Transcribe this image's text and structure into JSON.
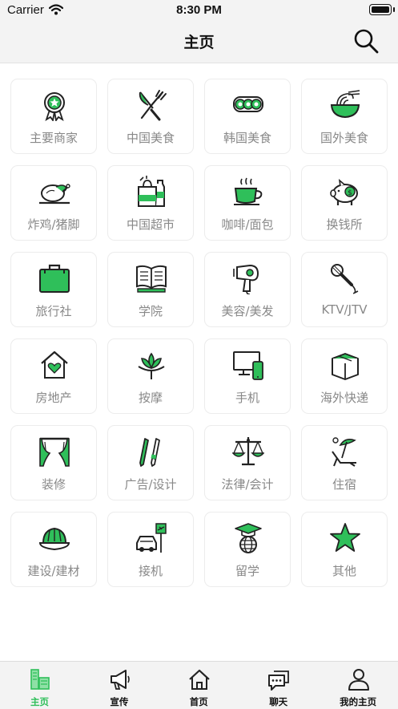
{
  "status_bar": {
    "carrier": "Carrier",
    "time": "8:30 PM"
  },
  "nav": {
    "title": "主页",
    "search_icon": "search-icon"
  },
  "accent_color": "#2fbf5a",
  "categories": [
    {
      "label": "主要商家",
      "icon": "award-ribbon-icon"
    },
    {
      "label": "中国美食",
      "icon": "knife-fork-icon"
    },
    {
      "label": "韩国美食",
      "icon": "kimbap-rolls-icon"
    },
    {
      "label": "国外美食",
      "icon": "noodle-bowl-icon"
    },
    {
      "label": "炸鸡/猪脚",
      "icon": "roast-chicken-icon"
    },
    {
      "label": "中国超市",
      "icon": "grocery-bag-icon"
    },
    {
      "label": "咖啡/面包",
      "icon": "coffee-cup-icon"
    },
    {
      "label": "换钱所",
      "icon": "piggy-bank-icon"
    },
    {
      "label": "旅行社",
      "icon": "suitcase-icon"
    },
    {
      "label": "学院",
      "icon": "open-book-icon"
    },
    {
      "label": "美容/美发",
      "icon": "hair-dryer-icon"
    },
    {
      "label": "KTV/JTV",
      "icon": "microphone-icon"
    },
    {
      "label": "房地产",
      "icon": "house-heart-icon"
    },
    {
      "label": "按摩",
      "icon": "lotus-icon"
    },
    {
      "label": "手机",
      "icon": "devices-icon"
    },
    {
      "label": "海外快递",
      "icon": "parcel-box-icon"
    },
    {
      "label": "装修",
      "icon": "curtains-icon"
    },
    {
      "label": "广告/设计",
      "icon": "pen-pencil-icon"
    },
    {
      "label": "法律/会计",
      "icon": "scales-icon"
    },
    {
      "label": "住宿",
      "icon": "beach-chair-icon"
    },
    {
      "label": "建设/建材",
      "icon": "hard-hat-icon"
    },
    {
      "label": "接机",
      "icon": "airport-car-icon"
    },
    {
      "label": "留学",
      "icon": "graduation-globe-icon"
    },
    {
      "label": "其他",
      "icon": "star-icon"
    }
  ],
  "tabs": [
    {
      "label": "主页",
      "icon": "home-grid-icon",
      "active": true
    },
    {
      "label": "宣传",
      "icon": "megaphone-icon",
      "active": false
    },
    {
      "label": "首页",
      "icon": "house-icon",
      "active": false
    },
    {
      "label": "聊天",
      "icon": "chat-bubbles-icon",
      "active": false
    },
    {
      "label": "我的主页",
      "icon": "user-icon",
      "active": false
    }
  ]
}
